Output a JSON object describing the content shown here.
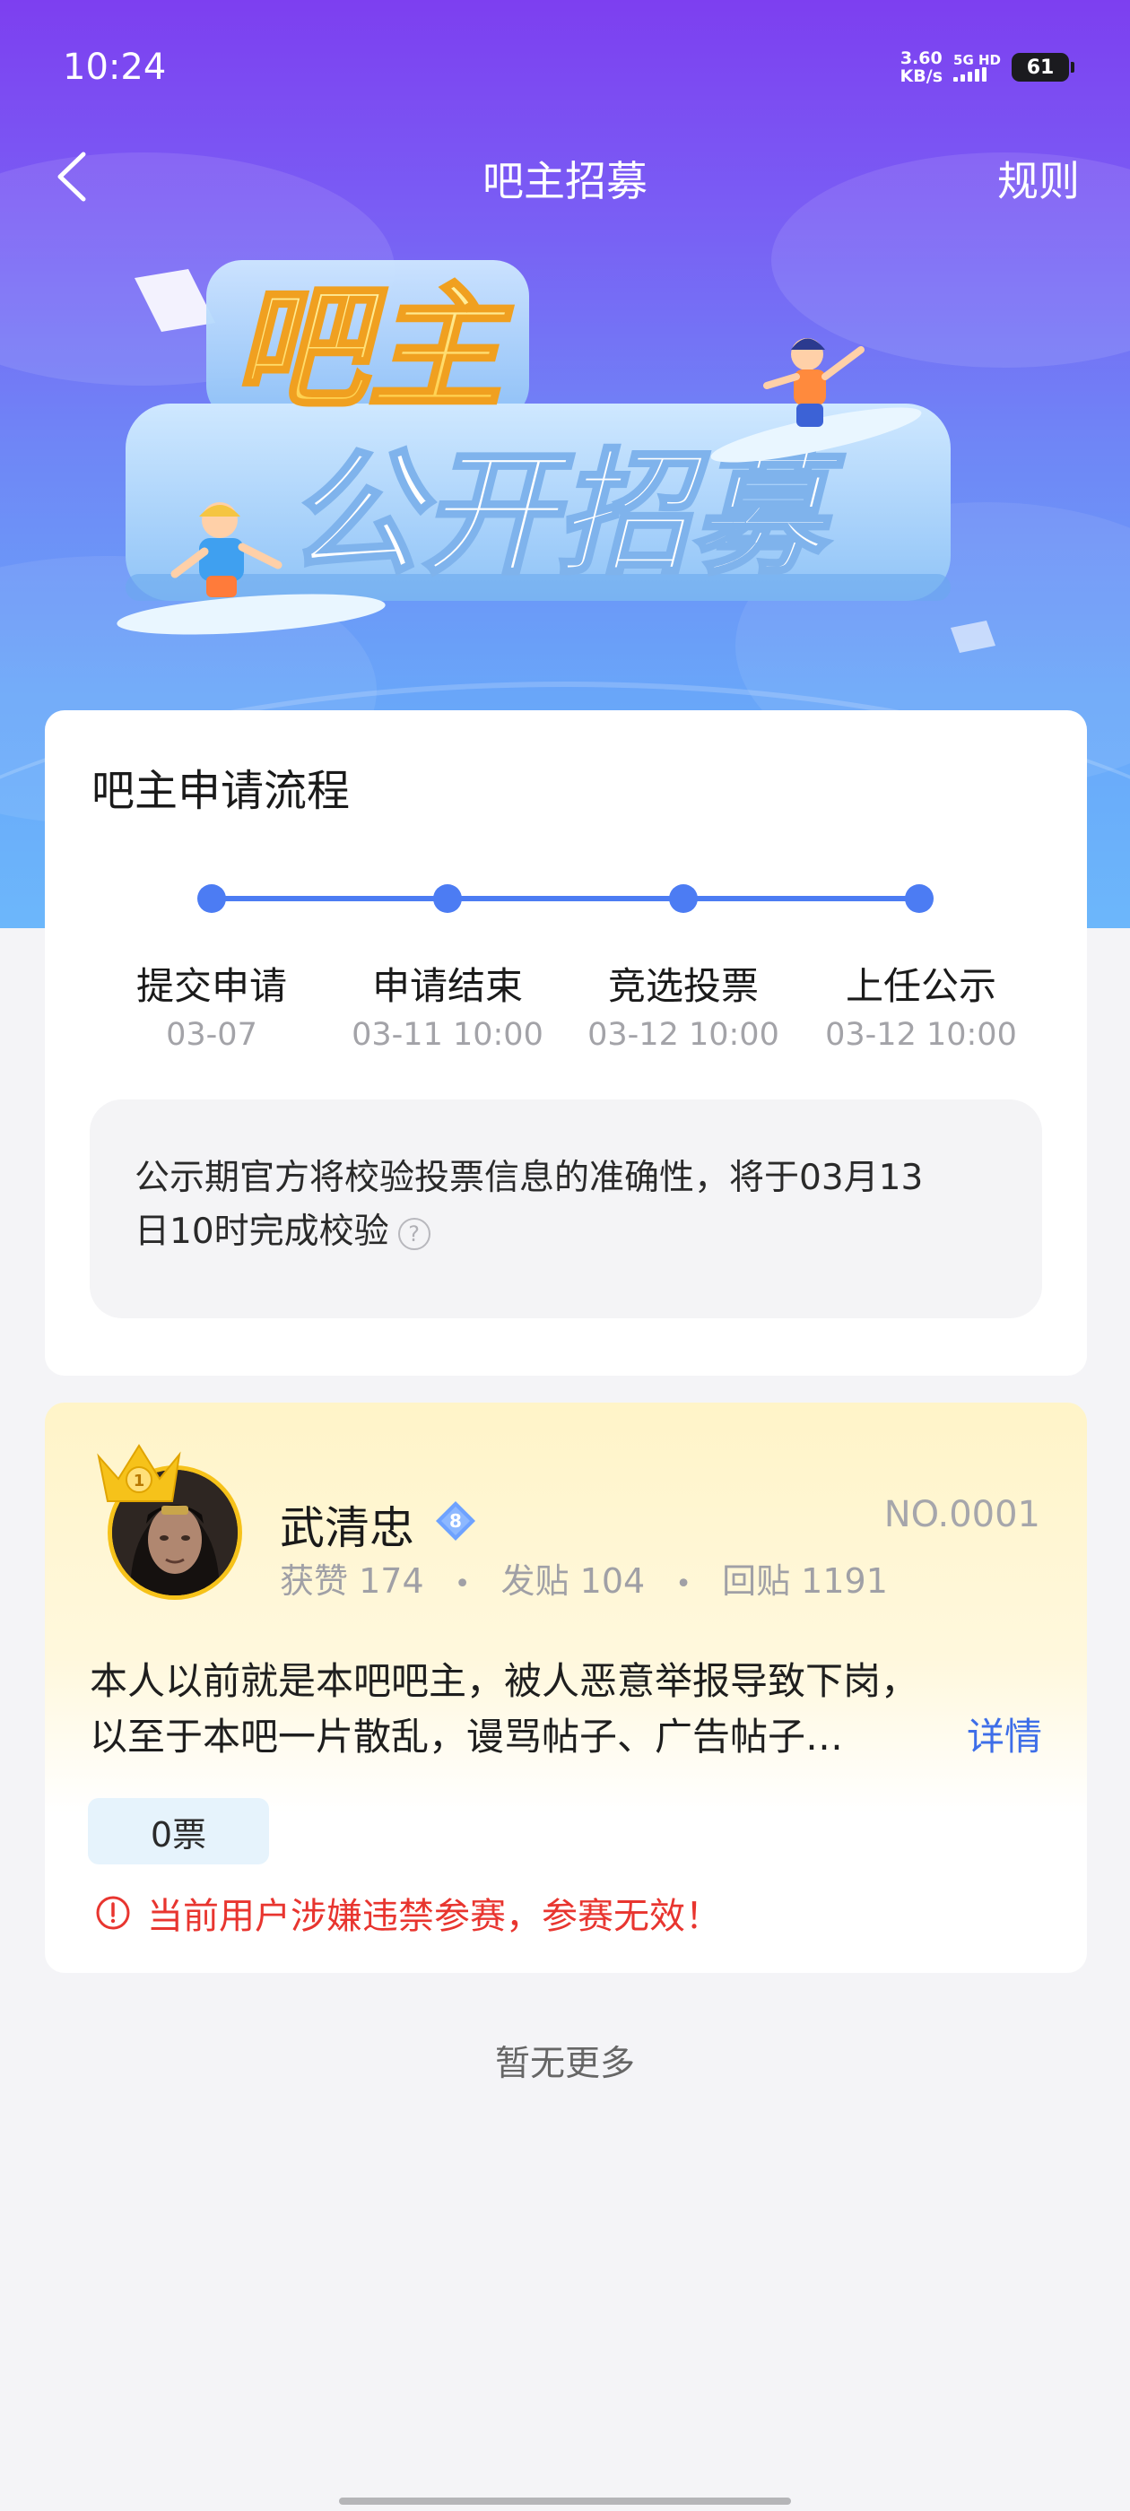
{
  "status_bar": {
    "time": "10:24",
    "net_speed_value": "3.60",
    "net_speed_unit": "KB/s",
    "signal_label": "5G HD",
    "battery": "61"
  },
  "nav": {
    "title": "吧主招募",
    "rules": "规则"
  },
  "banner": {
    "line1": "吧主",
    "line2": "公开招募"
  },
  "process": {
    "title": "吧主申请流程",
    "steps": [
      {
        "label": "提交申请",
        "date": "03-07"
      },
      {
        "label": "申请结束",
        "date": "03-11 10:00"
      },
      {
        "label": "竞选投票",
        "date": "03-12 10:00"
      },
      {
        "label": "上任公示",
        "date": "03-12 10:00"
      }
    ],
    "notice_line1": "公示期官方将校验投票信息的准确性，将于03月13",
    "notice_line2": "日10时完成校验",
    "help_icon": "?"
  },
  "candidate": {
    "rank_badge": "1",
    "name": "武清忠",
    "level": "8",
    "number": "NO.0001",
    "stats": [
      {
        "label": "获赞",
        "value": "174"
      },
      {
        "label": "发贴",
        "value": "104"
      },
      {
        "label": "回贴",
        "value": "1191"
      }
    ],
    "stat_separator": "•",
    "intro_line1": "本人以前就是本吧吧主，被人恶意举报导致下岗，",
    "intro_line2": "以至于本吧一片散乱，谩骂帖子、广告帖子…",
    "detail_link": "详情",
    "votes": "0票",
    "warning": "当前用户涉嫌违禁参赛，参赛无效！"
  },
  "footer": {
    "no_more": "暂无更多"
  },
  "colors": {
    "accent_blue": "#4c7cf3",
    "link_blue": "#3e6ee8",
    "warning_red": "#e8352f",
    "crown_gold": "#f6c21a"
  },
  "icons": {
    "back": "chevron-left-icon",
    "help": "question-circle-icon",
    "warning": "exclamation-circle-icon",
    "crown": "crown-icon",
    "level": "diamond-level-icon"
  }
}
